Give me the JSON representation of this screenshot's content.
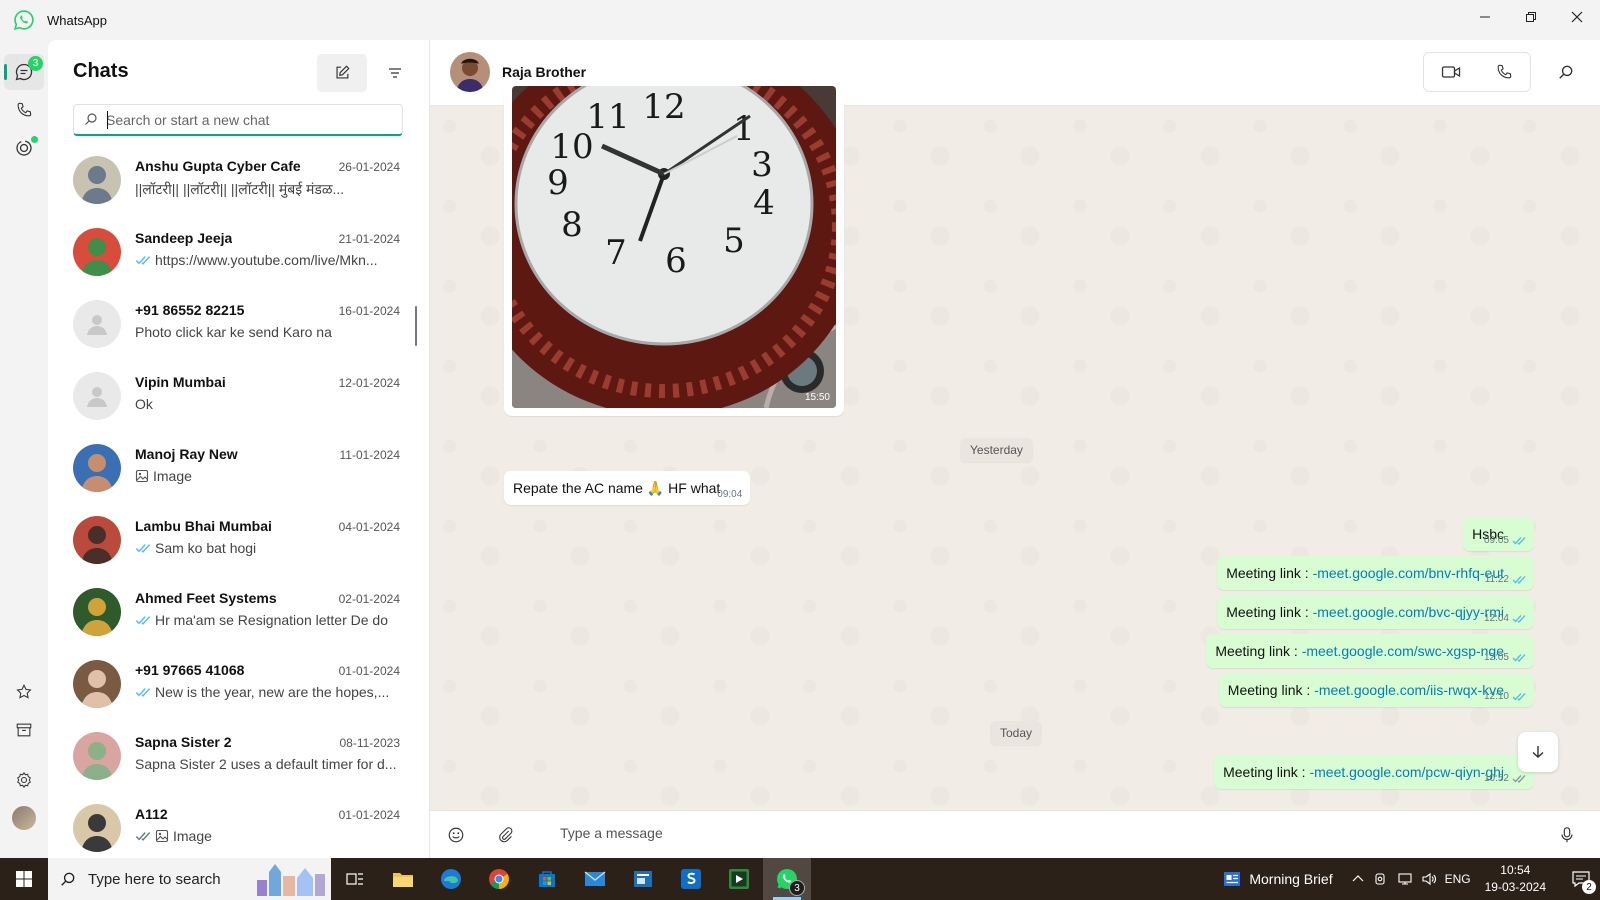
{
  "app": {
    "title": "WhatsApp",
    "brand_color": "#25d366",
    "accent_color": "#00a884"
  },
  "rail": {
    "chats_badge": "3",
    "items": [
      {
        "name": "chats-icon",
        "active": true
      },
      {
        "name": "calls-icon"
      },
      {
        "name": "status-icon"
      },
      {
        "name": "starred-icon"
      },
      {
        "name": "archive-icon"
      },
      {
        "name": "settings-icon"
      },
      {
        "name": "profile-avatar"
      }
    ]
  },
  "chatlist": {
    "title": "Chats",
    "search_placeholder": "Search or start a new chat",
    "chats": [
      {
        "name": "Anshu Gupta Cyber Cafe",
        "date": "26-01-2024",
        "preview": "||लॉटरी|| ||लॉटरी|| ||लॉटरी||   मुंबई मंडळ...",
        "ticks": "none",
        "icon": "",
        "avatar": "photo"
      },
      {
        "name": "Sandeep Jeeja",
        "date": "21-01-2024",
        "preview": "https://www.youtube.com/live/Mkn...",
        "ticks": "read",
        "icon": "",
        "avatar": "photo"
      },
      {
        "name": "+91 86552 82215",
        "date": "16-01-2024",
        "preview": "Photo click kar ke send Karo na",
        "ticks": "none",
        "icon": "",
        "avatar": "default"
      },
      {
        "name": "Vipin Mumbai",
        "date": "12-01-2024",
        "preview": "Ok",
        "ticks": "none",
        "icon": "",
        "avatar": "default"
      },
      {
        "name": "Manoj Ray New",
        "date": "11-01-2024",
        "preview": "Image",
        "ticks": "none",
        "icon": "image",
        "avatar": "photo"
      },
      {
        "name": "Lambu Bhai Mumbai",
        "date": "04-01-2024",
        "preview": "Sam ko bat hogi",
        "ticks": "read",
        "icon": "",
        "avatar": "photo"
      },
      {
        "name": "Ahmed Feet Systems",
        "date": "02-01-2024",
        "preview": "Hr ma'am se Resignation letter De do",
        "ticks": "read",
        "icon": "",
        "avatar": "photo"
      },
      {
        "name": "+91 97665 41068",
        "date": "01-01-2024",
        "preview": "New is the year, new are the hopes,...",
        "ticks": "read",
        "icon": "",
        "avatar": "photo"
      },
      {
        "name": "Sapna Sister 2",
        "date": "08-11-2023",
        "preview": "Sapna Sister 2 uses a default timer for d...",
        "ticks": "none",
        "icon": "",
        "avatar": "photo"
      },
      {
        "name": "A112",
        "date": "01-01-2024",
        "preview": "Image",
        "ticks": "delivered",
        "icon": "image",
        "avatar": "photo"
      }
    ]
  },
  "conversation": {
    "contact_name": "Raja Brother",
    "image_message_time": "15:50",
    "date_separators": [
      "Yesterday",
      "Today"
    ],
    "messages": [
      {
        "dir": "in",
        "text": "Repate the AC name 🙏 HF what",
        "time": "09:04"
      },
      {
        "dir": "out",
        "text": "Hsbc",
        "time": "09:05"
      },
      {
        "dir": "out",
        "prefix": "Meeting link : ",
        "link": "-meet.google.com/bnv-rhfq-eut",
        "time": "11:22"
      },
      {
        "dir": "out",
        "prefix": "Meeting link : ",
        "link": "-meet.google.com/bvc-qjyy-rmi",
        "time": "12:04"
      },
      {
        "dir": "out",
        "prefix": "Meeting link : ",
        "link": "-meet.google.com/swc-xgsp-nqe",
        "time": "12:05"
      },
      {
        "dir": "out",
        "prefix": "Meeting link : ",
        "link": "-meet.google.com/iis-rwqx-kve",
        "time": "12:10"
      },
      {
        "dir": "out",
        "prefix": "Meeting link : ",
        "link": "-meet.google.com/pcw-qiyn-ghj",
        "time": "10:52"
      }
    ],
    "composer_placeholder": "Type a message",
    "outgoing_bubble_color": "#d9fdd3",
    "link_color": "#027eb5"
  },
  "taskbar": {
    "search_placeholder": "Type here to search",
    "apps": [
      "task-view-icon",
      "file-explorer-icon",
      "edge-icon",
      "chrome-icon",
      "store-icon",
      "mail-icon",
      "app-icon",
      "skype-icon",
      "media-icon",
      "whatsapp-icon"
    ],
    "whatsapp_badge": "3",
    "news_label": "Morning Brief",
    "language": "ENG",
    "time": "10:54",
    "date": "19-03-2024",
    "notification_count": "2"
  }
}
